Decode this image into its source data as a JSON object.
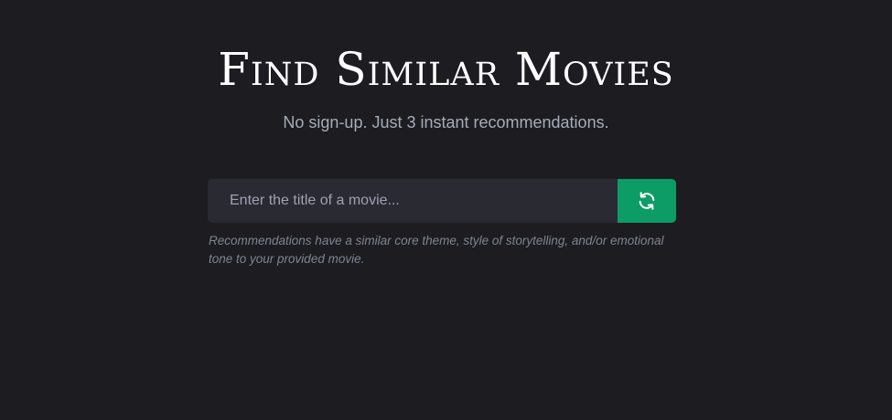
{
  "hero": {
    "title": "Find Similar Movies",
    "subtitle": "No sign-up. Just 3 instant recommendations."
  },
  "search": {
    "placeholder": "Enter the title of a movie...",
    "value": "",
    "button_icon": "refresh-icon"
  },
  "helper": {
    "text": "Recommendations have a similar core theme, style of storytelling, and/or emotional tone to your provided movie."
  },
  "colors": {
    "background": "#1c1c21",
    "input_background": "#2a2a33",
    "accent": "#0e9c66"
  }
}
